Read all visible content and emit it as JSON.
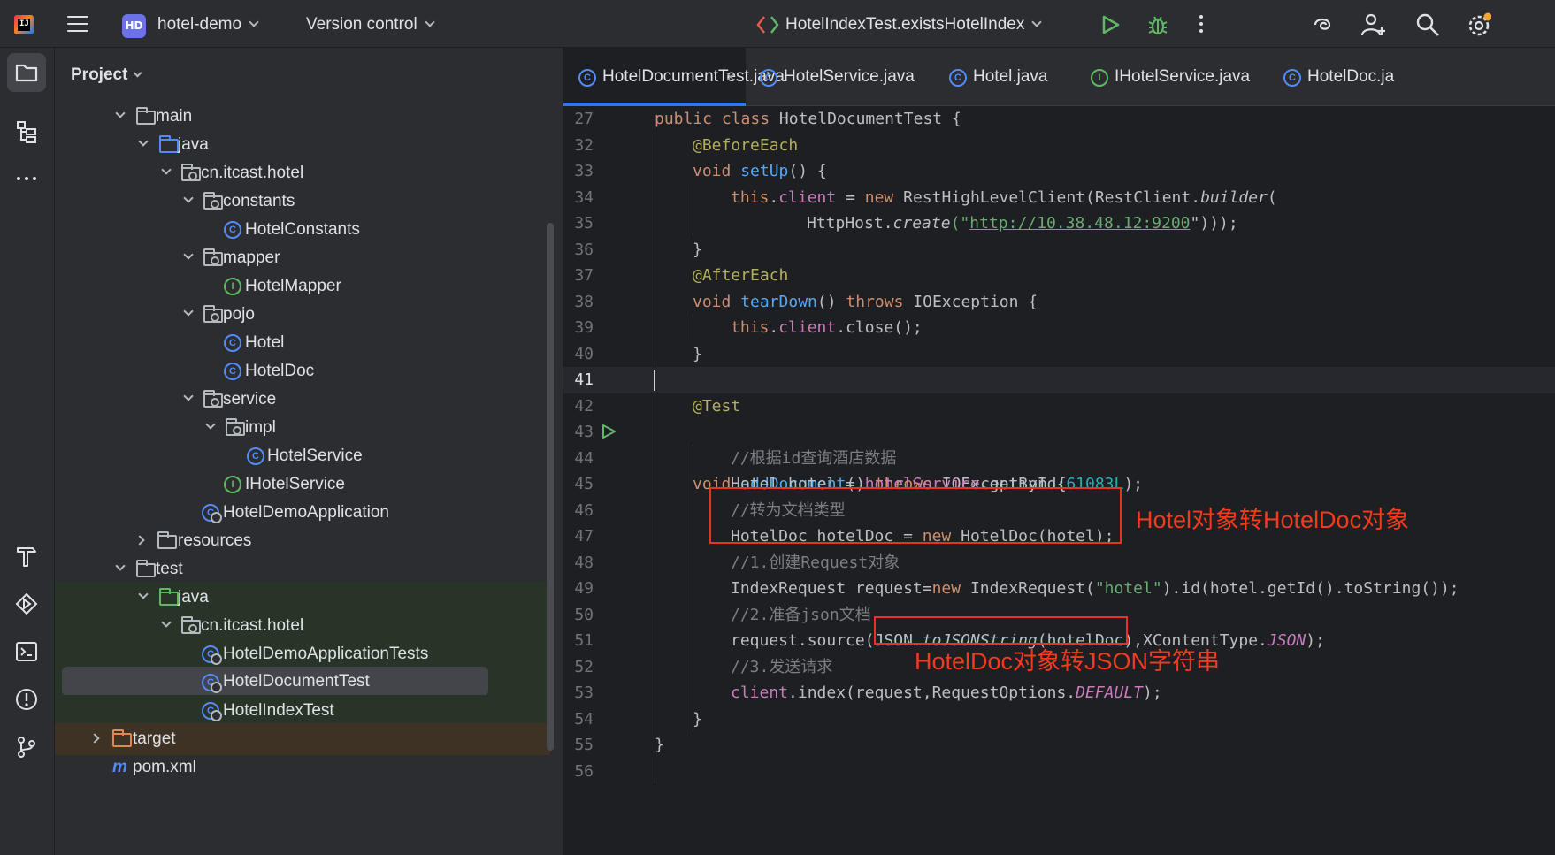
{
  "titlebar": {
    "project_badge": "HD",
    "project_name": "hotel-demo",
    "vcs_label": "Version control",
    "run_config": "HotelIndexTest.existsHotelIndex"
  },
  "project_panel": {
    "title": "Project",
    "tree": [
      {
        "label": "main",
        "type": "folder"
      },
      {
        "label": "java",
        "type": "source-folder"
      },
      {
        "label": "cn.itcast.hotel",
        "type": "package"
      },
      {
        "label": "constants",
        "type": "package"
      },
      {
        "label": "HotelConstants",
        "type": "class"
      },
      {
        "label": "mapper",
        "type": "package"
      },
      {
        "label": "HotelMapper",
        "type": "interface"
      },
      {
        "label": "pojo",
        "type": "package"
      },
      {
        "label": "Hotel",
        "type": "class"
      },
      {
        "label": "HotelDoc",
        "type": "class"
      },
      {
        "label": "service",
        "type": "package"
      },
      {
        "label": "impl",
        "type": "package"
      },
      {
        "label": "HotelService",
        "type": "class"
      },
      {
        "label": "IHotelService",
        "type": "interface"
      },
      {
        "label": "HotelDemoApplication",
        "type": "spring-class"
      },
      {
        "label": "resources",
        "type": "resources-folder"
      },
      {
        "label": "test",
        "type": "folder"
      },
      {
        "label": "java",
        "type": "test-folder"
      },
      {
        "label": "cn.itcast.hotel",
        "type": "package"
      },
      {
        "label": "HotelDemoApplicationTests",
        "type": "test-class"
      },
      {
        "label": "HotelDocumentTest",
        "type": "test-class",
        "selected": true
      },
      {
        "label": "HotelIndexTest",
        "type": "test-class"
      },
      {
        "label": "target",
        "type": "excluded-folder"
      },
      {
        "label": "pom.xml",
        "type": "maven-file"
      }
    ]
  },
  "tabs": [
    {
      "label": "HotelDocumentTest.java",
      "active": true,
      "close": "×"
    },
    {
      "label": "HotelService.java"
    },
    {
      "label": "Hotel.java"
    },
    {
      "label": "IHotelService.java"
    },
    {
      "label": "HotelDoc.ja"
    }
  ],
  "editor": {
    "line_numbers": [
      "27",
      "32",
      "33",
      "34",
      "35",
      "36",
      "37",
      "38",
      "39",
      "40",
      "41",
      "42",
      "43",
      "44",
      "45",
      "46",
      "47",
      "48",
      "49",
      "50",
      "51",
      "52",
      "53",
      "54",
      "55",
      "56"
    ],
    "current_line": "41",
    "lines": {
      "l27": {
        "a": "public class ",
        "b": "HotelDocumentTest {"
      },
      "l32": {
        "a": "@BeforeEach"
      },
      "l33": {
        "a": "void ",
        "b": "setUp",
        "c": "() {"
      },
      "l34": {
        "a": "this",
        "b": ".",
        "c": "client",
        "d": " = ",
        "e": "new ",
        "f": "RestHighLevelClient(RestClient.",
        "g": "builder",
        "h": "("
      },
      "l35": {
        "a": "HttpHost.",
        "b": "create",
        "c": "(\"",
        "d": "http://10.38.48.12:9200",
        "e": "\")));"
      },
      "l36": {
        "a": "}"
      },
      "l37": {
        "a": "@AfterEach"
      },
      "l38": {
        "a": "void ",
        "b": "tearDown",
        "c": "() ",
        "d": "throws ",
        "e": "IOException {"
      },
      "l39": {
        "a": "this",
        "b": ".",
        "c": "client",
        "d": ".close();"
      },
      "l40": {
        "a": "}"
      },
      "l42": {
        "a": "@Test"
      },
      "l43": {
        "a": "void ",
        "b": "addDocument",
        "c": "() ",
        "d": "throws ",
        "e": "IOException {"
      },
      "l44": {
        "a": "//根据id查询酒店数据"
      },
      "l45": {
        "a": "Hotel hotel = ",
        "b": "hotelService",
        "c": ".getById(",
        "d": "61083L",
        "e": ");"
      },
      "l46": {
        "a": "//转为文档类型"
      },
      "l47": {
        "a": "HotelDoc hotelDoc = ",
        "b": "new ",
        "c": "HotelDoc(hotel);"
      },
      "l48": {
        "a": "//1.创建Request对象"
      },
      "l49": {
        "a": "IndexRequest request=",
        "b": "new ",
        "c": "IndexRequest(",
        "d": "\"hotel\"",
        "e": ").id(hotel.getId().toString());"
      },
      "l50": {
        "a": "//2.准备json文档"
      },
      "l51": {
        "a": "request.source(JSON.",
        "b": "toJSONString",
        "c": "(hotelDoc),XContentType.",
        "d": "JSON",
        "e": ");"
      },
      "l52": {
        "a": "//3.发送请求"
      },
      "l53": {
        "a": "client",
        "b": ".index(request,RequestOptions.",
        "c": "DEFAULT",
        "d": ");"
      },
      "l54": {
        "a": "}"
      },
      "l55": {
        "a": "}"
      }
    }
  },
  "annotations": {
    "note1": "Hotel对象转HotelDoc对象",
    "note2": "HotelDoc对象转JSON字符串",
    "color": "#e8331f"
  },
  "icons": {
    "toolbar": [
      "hamburger-menu-icon",
      "run-icon",
      "debug-icon",
      "more-icon",
      "ai-assistant-icon",
      "add-user-icon",
      "search-icon",
      "settings-icon"
    ],
    "left_strip": [
      "project-folder-icon",
      "structure-icon",
      "more-tools-icon",
      "build-hammer-icon",
      "run-services-icon",
      "terminal-icon",
      "problems-icon",
      "git-icon"
    ]
  }
}
